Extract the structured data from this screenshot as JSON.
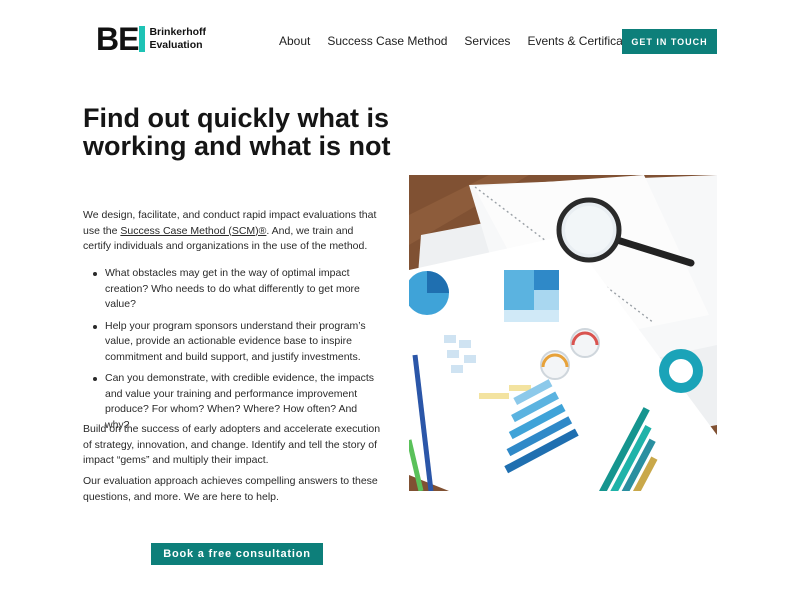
{
  "logo": {
    "mark": "BE",
    "line1": "Brinkerhoff",
    "line2": "Evaluation"
  },
  "nav": {
    "items": [
      "About",
      "Success Case Method",
      "Services",
      "Events & Certifications"
    ],
    "cta": "GET IN TOUCH"
  },
  "hero": {
    "headline": "Find out quickly what is working and what is not",
    "intro_before_link": "We design, facilitate, and conduct rapid impact evaluations that use the ",
    "intro_link": "Success Case Method (SCM)®",
    "intro_after_link": ". And, we train and certify individuals and organizations in the use of the method.",
    "bullets": [
      "What obstacles may get in the way of optimal impact creation? Who needs to do what differently to get more value?",
      "Help your program sponsors understand their program’s value, provide an actionable evidence base to inspire commitment and build support, and justify investments.",
      "Can you demonstrate, with credible evidence, the impacts and value your training and performance improvement produce?  For whom? When? Where? How often? And why?"
    ],
    "para2": "Build on the success of early adopters and accelerate execution of strategy, innovation, and change. Identify and tell the story of impact “gems” and multiply their impact.",
    "para3": "Our evaluation approach achieves compelling answers to these questions, and more. We are here to help.",
    "cta": "Book a free consultation"
  },
  "colors": {
    "accent": "#0d7f7a",
    "logo_bar": "#1ec3b5"
  }
}
